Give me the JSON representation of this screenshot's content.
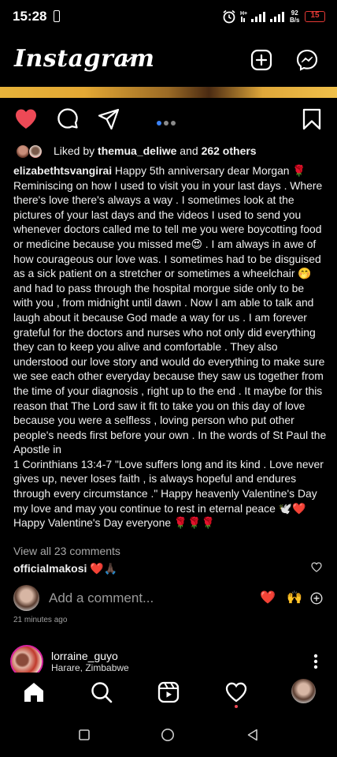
{
  "status_bar": {
    "time": "15:28",
    "net_speed_value": "92",
    "net_speed_unit": "B/s",
    "battery": "15"
  },
  "header": {
    "brand": "Instagram",
    "icons": [
      "chevron-down-icon",
      "new-post-icon",
      "messenger-icon"
    ]
  },
  "post": {
    "liked_by_prefix": "Liked by ",
    "liked_by_user": "themua_deliwe",
    "liked_by_mid": " and ",
    "liked_by_count": "262 others",
    "caption_user": "elizabethtsvangirai",
    "caption_text": " Happy 5th anniversary dear Morgan 🌹\nReminiscing on how I used to visit you in your last days . Where\nthere's love there's always a way . I sometimes look at the\npictures of your last days and the videos I used to send you\nwhenever doctors called me to tell me you were boycotting food\nor medicine because you missed me😍 . I am always in awe of\nhow courageous our love was. I sometimes had to be disguised\nas a sick patient on a stretcher or sometimes a wheelchair 🤭\nand had to pass through the hospital morgue side only to be\nwith you , from midnight until dawn . Now I am able to talk and\nlaugh about it because God made a way for us . I am forever\ngrateful for the doctors and nurses who not only did everything\nthey can to keep you alive and comfortable . They also\nunderstood our love story and would do everything to make sure\nwe see each other everyday because they saw us together from\nthe time of your diagnosis , right up to the end . It maybe for this\nreason that The Lord saw it fit to take you on this day of love\nbecause you were a selfless , loving  person who put other\npeople's needs first before your own . In the words of St Paul the\nApostle in\n1 Corinthians 13:4-7 \"Love suffers long and its kind . Love never\ngives up, never loses faith , is always hopeful and endures\nthrough every circumstance .\" Happy heavenly Valentine's Day\nmy love and may you continue to rest in eternal peace 🕊️❤️\nHappy Valentine's Day everyone 🌹🌹🌹",
    "view_all_comments": "View all 23 comments",
    "comment_user": "officialmakosi",
    "comment_text": " ❤️🙏🏿",
    "add_comment_placeholder": "Add a comment...",
    "quick_reactions": [
      "❤️",
      "🙌"
    ],
    "time_ago": "21 minutes ago"
  },
  "next_post": {
    "username": "lorraine_guyo",
    "location": "Harare, Zimbabwe"
  },
  "colors": {
    "like_red": "#ed4956",
    "dot_active": "#3b82f6",
    "battery_low": "#e53935"
  }
}
